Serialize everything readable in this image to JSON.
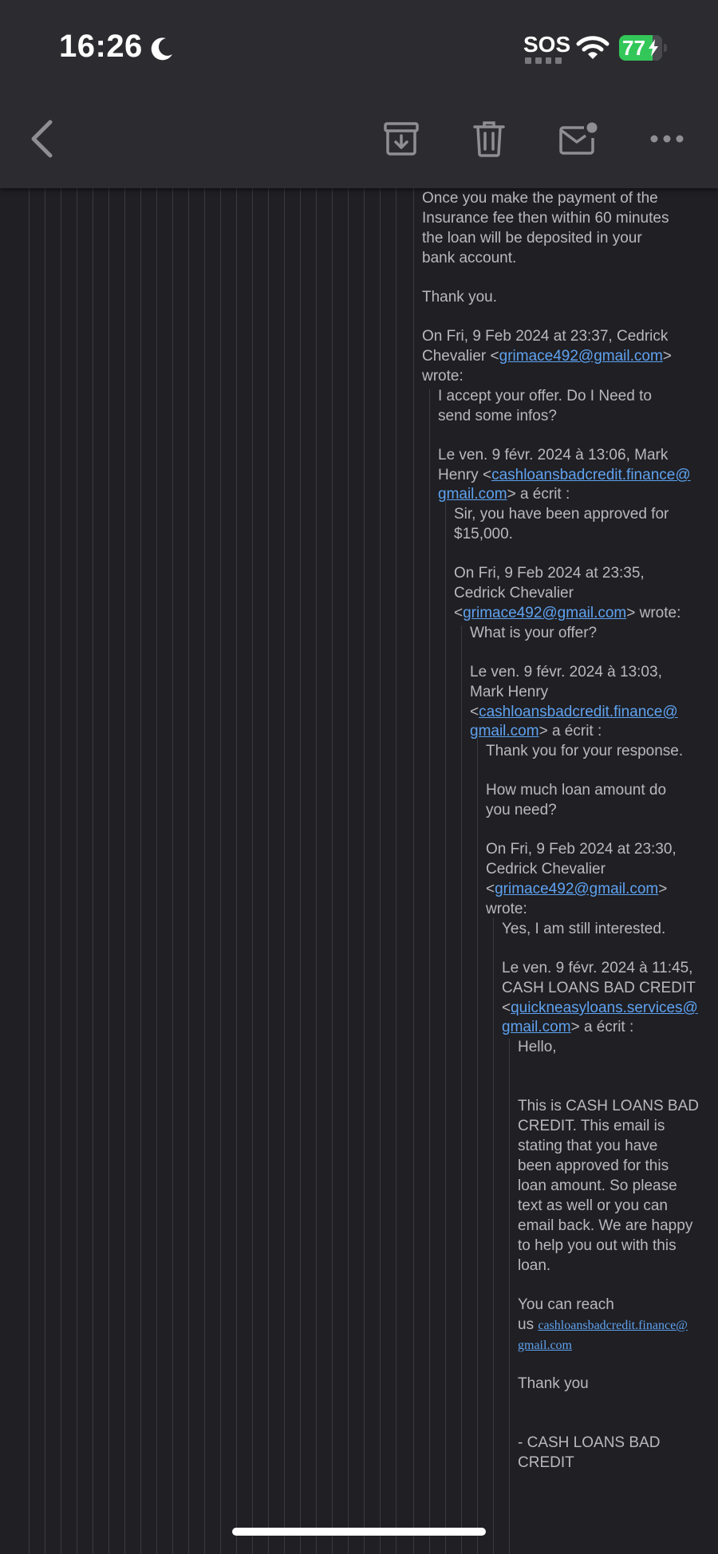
{
  "status": {
    "time": "16:26",
    "sos": "SOS",
    "battery": "77"
  },
  "toolbar": {
    "back_icon": "chevron-left-icon",
    "archive_icon": "archive-icon",
    "trash_icon": "trash-icon",
    "mark_unread_icon": "mail-unread-icon",
    "more_icon": "more-horizontal-icon"
  },
  "thread": {
    "m1": {
      "p1_l1": "Once you make the payment of the",
      "p1_l2": "Insurance fee then within 60 minutes",
      "p1_l3": "the loan will be deposited in your",
      "p1_l4": "bank account.",
      "thanks": "Thank you.",
      "q_l1": "On Fri, 9 Feb 2024 at 23:37, Cedrick",
      "q_l2_pre": "Chevalier <",
      "q_l2_link": "grimace492@gmail.com",
      "q_l2_post": ">",
      "q_l3": "wrote:"
    },
    "m2": {
      "l1": "I accept your offer. Do I Need to",
      "l2": "send some infos?",
      "q_l1": "Le ven. 9 févr. 2024 à 13:06, Mark",
      "q_l2_pre": "Henry <",
      "q_l2_link": "cashloansbadcredit.finance@",
      "q_l3_link": "gmail.com",
      "q_l3_post": "> a écrit :"
    },
    "m3": {
      "l1": "Sir, you have been approved for",
      "l2": "$15,000.",
      "q_l1": "On Fri, 9 Feb 2024 at 23:35,",
      "q_l2": "Cedrick Chevalier",
      "q_l3_pre": "<",
      "q_l3_link": "grimace492@gmail.com",
      "q_l3_post": "> wrote:"
    },
    "m4": {
      "l1": "What is your offer?",
      "q_l1": "Le ven. 9 févr. 2024 à 13:03,",
      "q_l2": "Mark Henry",
      "q_l3_pre": "<",
      "q_l3_link": "cashloansbadcredit.finance@",
      "q_l4_link": "gmail.com",
      "q_l4_post": "> a écrit :"
    },
    "m5": {
      "l1": "Thank you for your response.",
      "l2": "How much loan amount do",
      "l3": "you need?",
      "q_l1": "On Fri, 9 Feb 2024 at 23:30,",
      "q_l2": "Cedrick Chevalier",
      "q_l3_pre": "<",
      "q_l3_link": "grimace492@gmail.com",
      "q_l3_post": ">",
      "q_l4": "wrote:"
    },
    "m6": {
      "l1": "Yes, I am still interested.",
      "q_l1": "Le ven. 9 févr. 2024 à 11:45,",
      "q_l2": "CASH LOANS BAD CREDIT",
      "q_l3_pre": "<",
      "q_l3_link": "quickneasyloans.services@",
      "q_l4_link": "gmail.com",
      "q_l4_post": "> a écrit :"
    },
    "m7": {
      "hello": "Hello,",
      "b1": "This is CASH LOANS BAD",
      "b2": "CREDIT. This email is",
      "b3": "stating that you have",
      "b4": "been approved for this",
      "b5": "loan amount. So please",
      "b6": "text as well or you can",
      "b7": "email back. We are happy",
      "b8": "to help you out with this",
      "b9": "loan.",
      "r1": "You can reach",
      "r2_pre": "us ",
      "r2_link": "cashloansbadcredit.finance@",
      "r3_link": "gmail.com",
      "thanks": "Thank you",
      "sig1": "- CASH LOANS BAD",
      "sig2": "CREDIT"
    }
  }
}
